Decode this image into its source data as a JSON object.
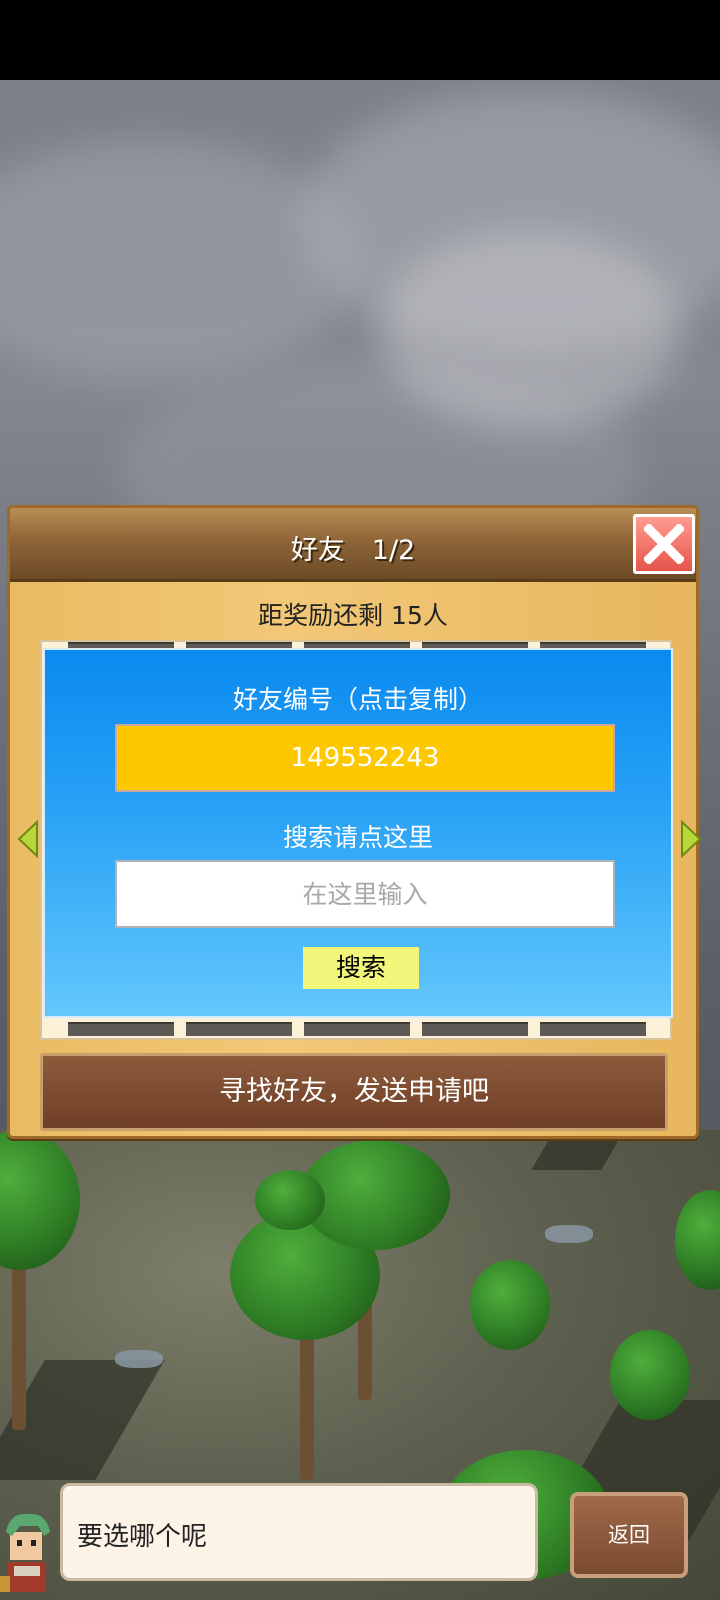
{
  "friends_panel": {
    "title": "好友　1/2",
    "reward_remaining": "距奖励还剩 15人",
    "friend_id_label": "好友编号（点击复制）",
    "friend_id_value": "149552243",
    "search_hint": "搜索请点这里",
    "search_placeholder": "在这里输入",
    "search_button": "搜索",
    "find_friends_button": "寻找好友，发送申请吧"
  },
  "dialog": {
    "message": "要选哪个呢",
    "back_button": "返回"
  },
  "icons": {
    "close": "close-icon",
    "left_arrow": "arrow-left-icon",
    "right_arrow": "arrow-right-icon"
  },
  "colors": {
    "panel_bg": "#f2c877",
    "card_bg": "#2aa3f6",
    "id_value_bg": "#fec800",
    "search_button_bg": "#f2f77b",
    "close_button_bg": "#e6544a",
    "find_button_bg": "#6f3f26"
  }
}
